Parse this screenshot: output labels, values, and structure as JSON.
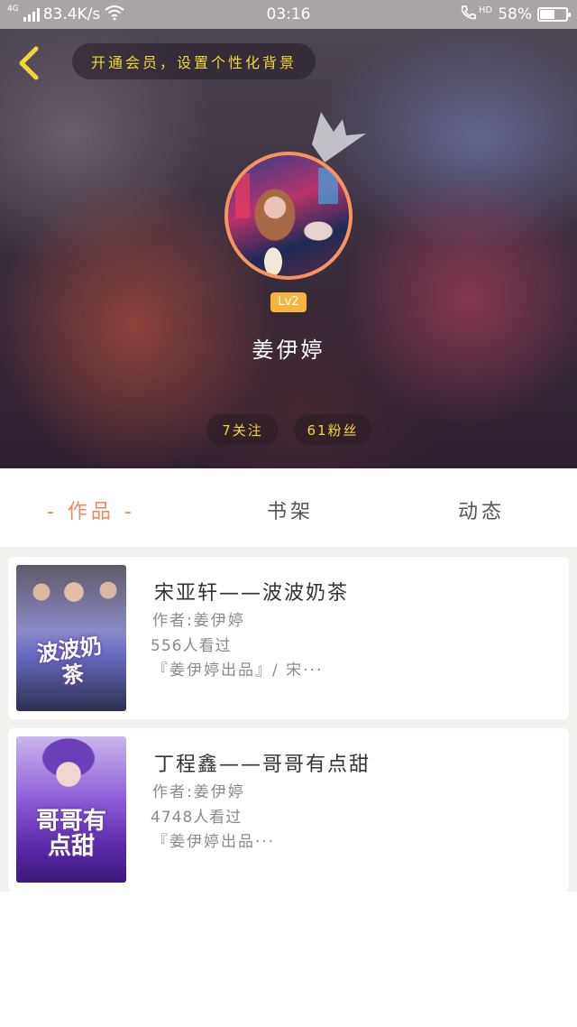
{
  "status_bar": {
    "network_type": "4G",
    "speed": "83.4K/s",
    "time": "03:16",
    "call_tag": "HD",
    "battery_percent": "58%",
    "battery_level": 0.58
  },
  "header": {
    "vip_banner": "开通会员，设置个性化背景",
    "level": "Lv2",
    "user_name": "姜伊婷",
    "following": "7关注",
    "fans": "61粉丝",
    "accent_color": "#f2d63a"
  },
  "tabs": [
    {
      "label": "- 作品 -",
      "active": true
    },
    {
      "label": "书架",
      "active": false
    },
    {
      "label": "动态",
      "active": false
    }
  ],
  "books": [
    {
      "title": "宋亚轩——波波奶茶",
      "author": "作者:姜伊婷",
      "views": "556人看过",
      "description": "『姜伊婷出品』/ 宋···",
      "cover_text": "波波奶茶"
    },
    {
      "title": "丁程鑫——哥哥有点甜",
      "author": "作者:姜伊婷",
      "views": "4748人看过",
      "description": "『姜伊婷出品···",
      "cover_text": "哥哥有点甜"
    }
  ]
}
